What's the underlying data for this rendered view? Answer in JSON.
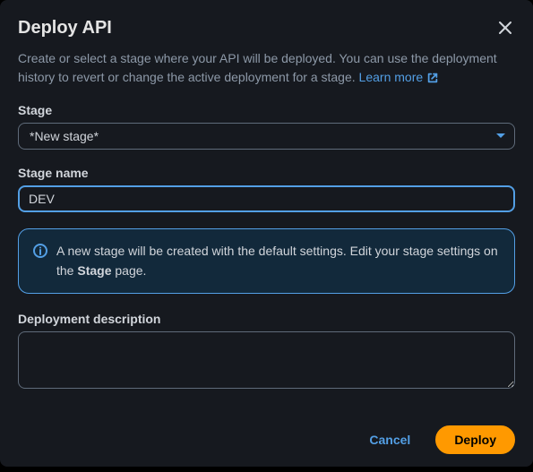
{
  "modal": {
    "title": "Deploy API",
    "description_pre": "Create or select a stage where your API will be deployed. You can use the deployment history to revert or change the active deployment for a stage. ",
    "learn_more": "Learn more"
  },
  "stage": {
    "label": "Stage",
    "selected": "*New stage*"
  },
  "stage_name": {
    "label": "Stage name",
    "value": "DEV"
  },
  "alert": {
    "text_pre": "A new stage will be created with the default settings. Edit your stage settings on the ",
    "text_bold": "Stage",
    "text_post": " page."
  },
  "description": {
    "label": "Deployment description",
    "value": ""
  },
  "buttons": {
    "cancel": "Cancel",
    "deploy": "Deploy"
  }
}
